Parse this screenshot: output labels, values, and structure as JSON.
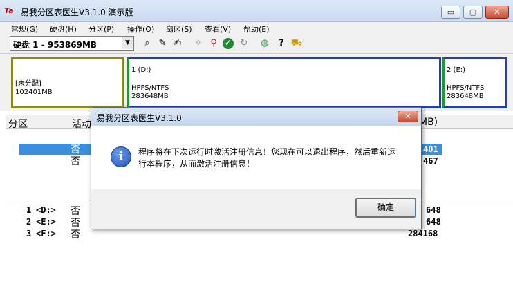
{
  "window": {
    "title": "易我分区表医生V3.1.0 演示版",
    "logo_text": "Ta",
    "min": "▭",
    "max": "▢",
    "close": "✕"
  },
  "menu": [
    "常规(G)",
    "硬盘(H)",
    "分区(P)",
    "操作(O)",
    "扇区(S)",
    "查看(V)",
    "帮助(E)"
  ],
  "toolbar": {
    "disk": "硬盘 1 - 953869MB"
  },
  "partitions": [
    {
      "line1": "",
      "line2": "[未分配]",
      "line3": "102401MB",
      "color": "#8a8a1e"
    },
    {
      "line1": "1 (D:)",
      "line2": "HPFS/NTFS",
      "line3": "283648MB",
      "color": "#1f3fbf"
    },
    {
      "line1": "2 (E:)",
      "line2": "HPFS/NTFS",
      "line3": "283648MB",
      "color": "#1f3fbf"
    }
  ],
  "list": {
    "col_partition": "分区",
    "col_active": "活动",
    "col_size_tail": "MB)",
    "upper_rows": [
      {
        "active": "否",
        "size": "401"
      },
      {
        "active": "否",
        "size": "467"
      }
    ],
    "lower_rows": [
      {
        "num": "1",
        "drive": "<D:>",
        "active": "否",
        "size": "648"
      },
      {
        "num": "2",
        "drive": "<E:>",
        "active": "否",
        "size": "648"
      },
      {
        "num": "3",
        "drive": "<F:>",
        "active": "否",
        "size": "284168"
      }
    ]
  },
  "dialog": {
    "title": "易我分区表医生V3.1.0",
    "message": "程序将在下次运行时激活注册信息！您现在可以退出程序，然后重新运行本程序，从而激活注册信息！",
    "ok_label": "确定",
    "close_glyph": "✕",
    "icon_glyph": "i"
  }
}
